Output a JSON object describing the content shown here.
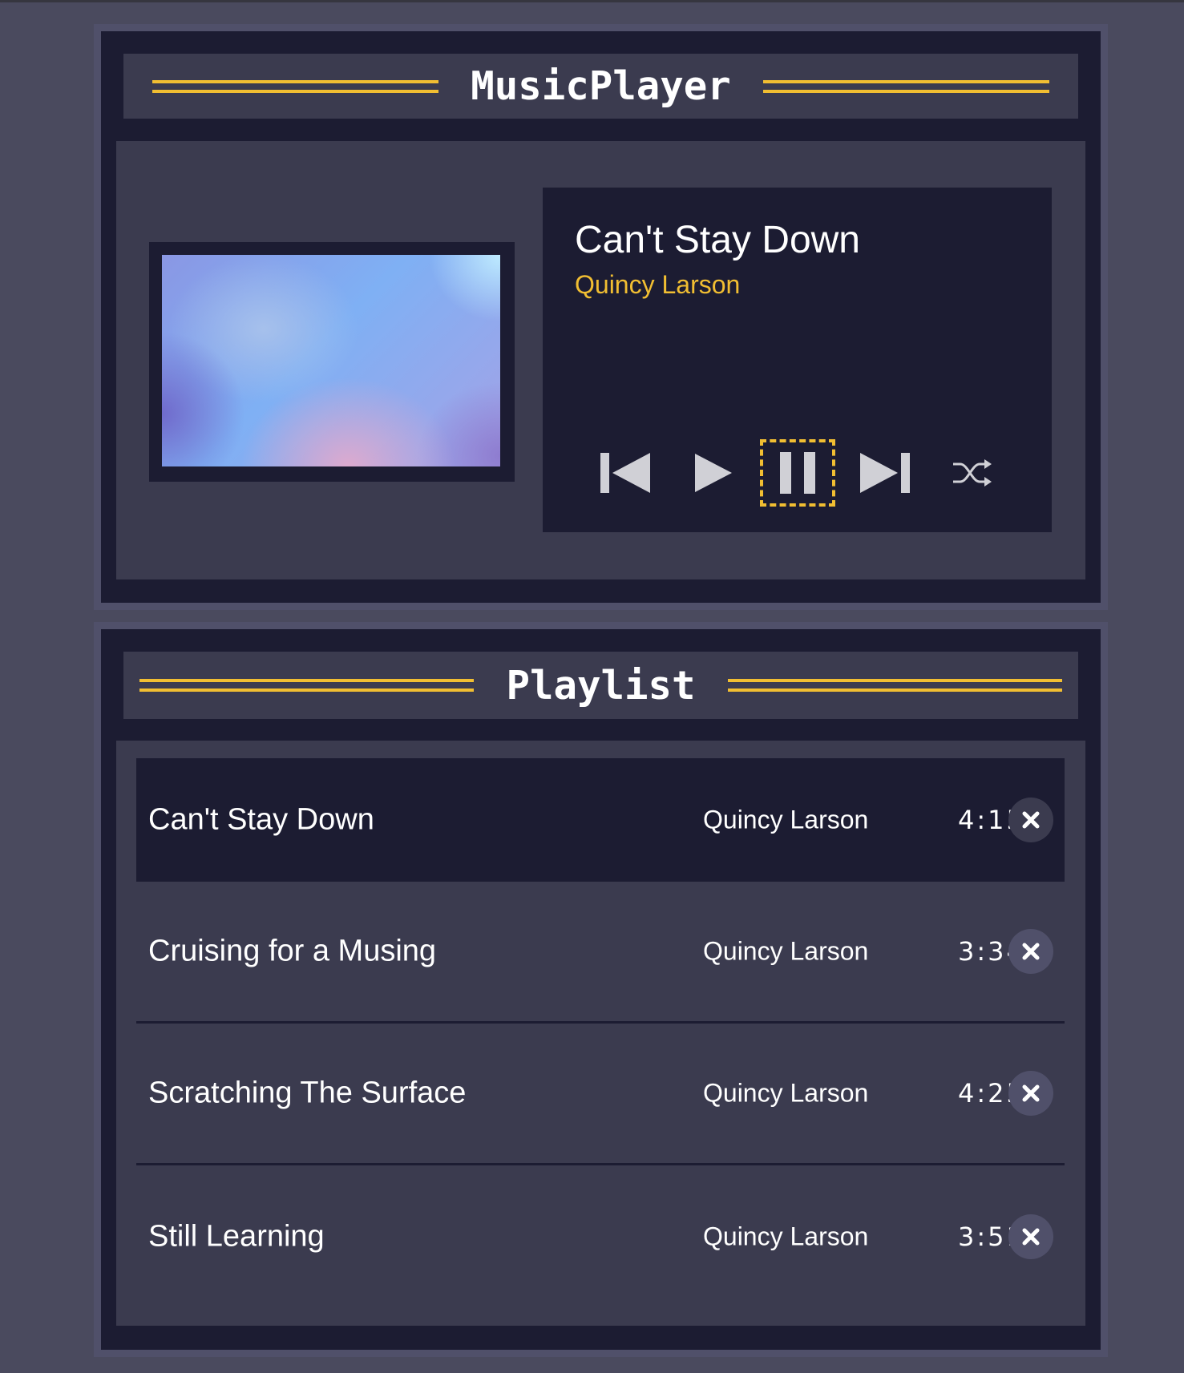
{
  "player": {
    "header_title": "MusicPlayer",
    "current_song": {
      "title": "Can't Stay Down",
      "artist": "Quincy Larson"
    },
    "controls": [
      {
        "name": "previous",
        "icon": "skip-previous-icon"
      },
      {
        "name": "play",
        "icon": "play-icon"
      },
      {
        "name": "pause",
        "icon": "pause-icon",
        "focused": true
      },
      {
        "name": "next",
        "icon": "skip-next-icon"
      },
      {
        "name": "shuffle",
        "icon": "shuffle-icon"
      }
    ]
  },
  "playlist": {
    "header_title": "Playlist",
    "songs": [
      {
        "title": "Can't Stay Down",
        "artist": "Quincy Larson",
        "duration": "4:15",
        "active": true
      },
      {
        "title": "Cruising for a Musing",
        "artist": "Quincy Larson",
        "duration": "3:34",
        "active": false
      },
      {
        "title": "Scratching The Surface",
        "artist": "Quincy Larson",
        "duration": "4:25",
        "active": false
      },
      {
        "title": "Still Learning",
        "artist": "Quincy Larson",
        "duration": "3:51",
        "active": false
      }
    ],
    "delete_icon": "close-icon"
  },
  "colors": {
    "page_background": "#4a4a5e",
    "panel_dark": "#1c1c32",
    "panel_mid": "#3b3b4f",
    "accent": "#f1be32",
    "text": "#ffffff"
  }
}
